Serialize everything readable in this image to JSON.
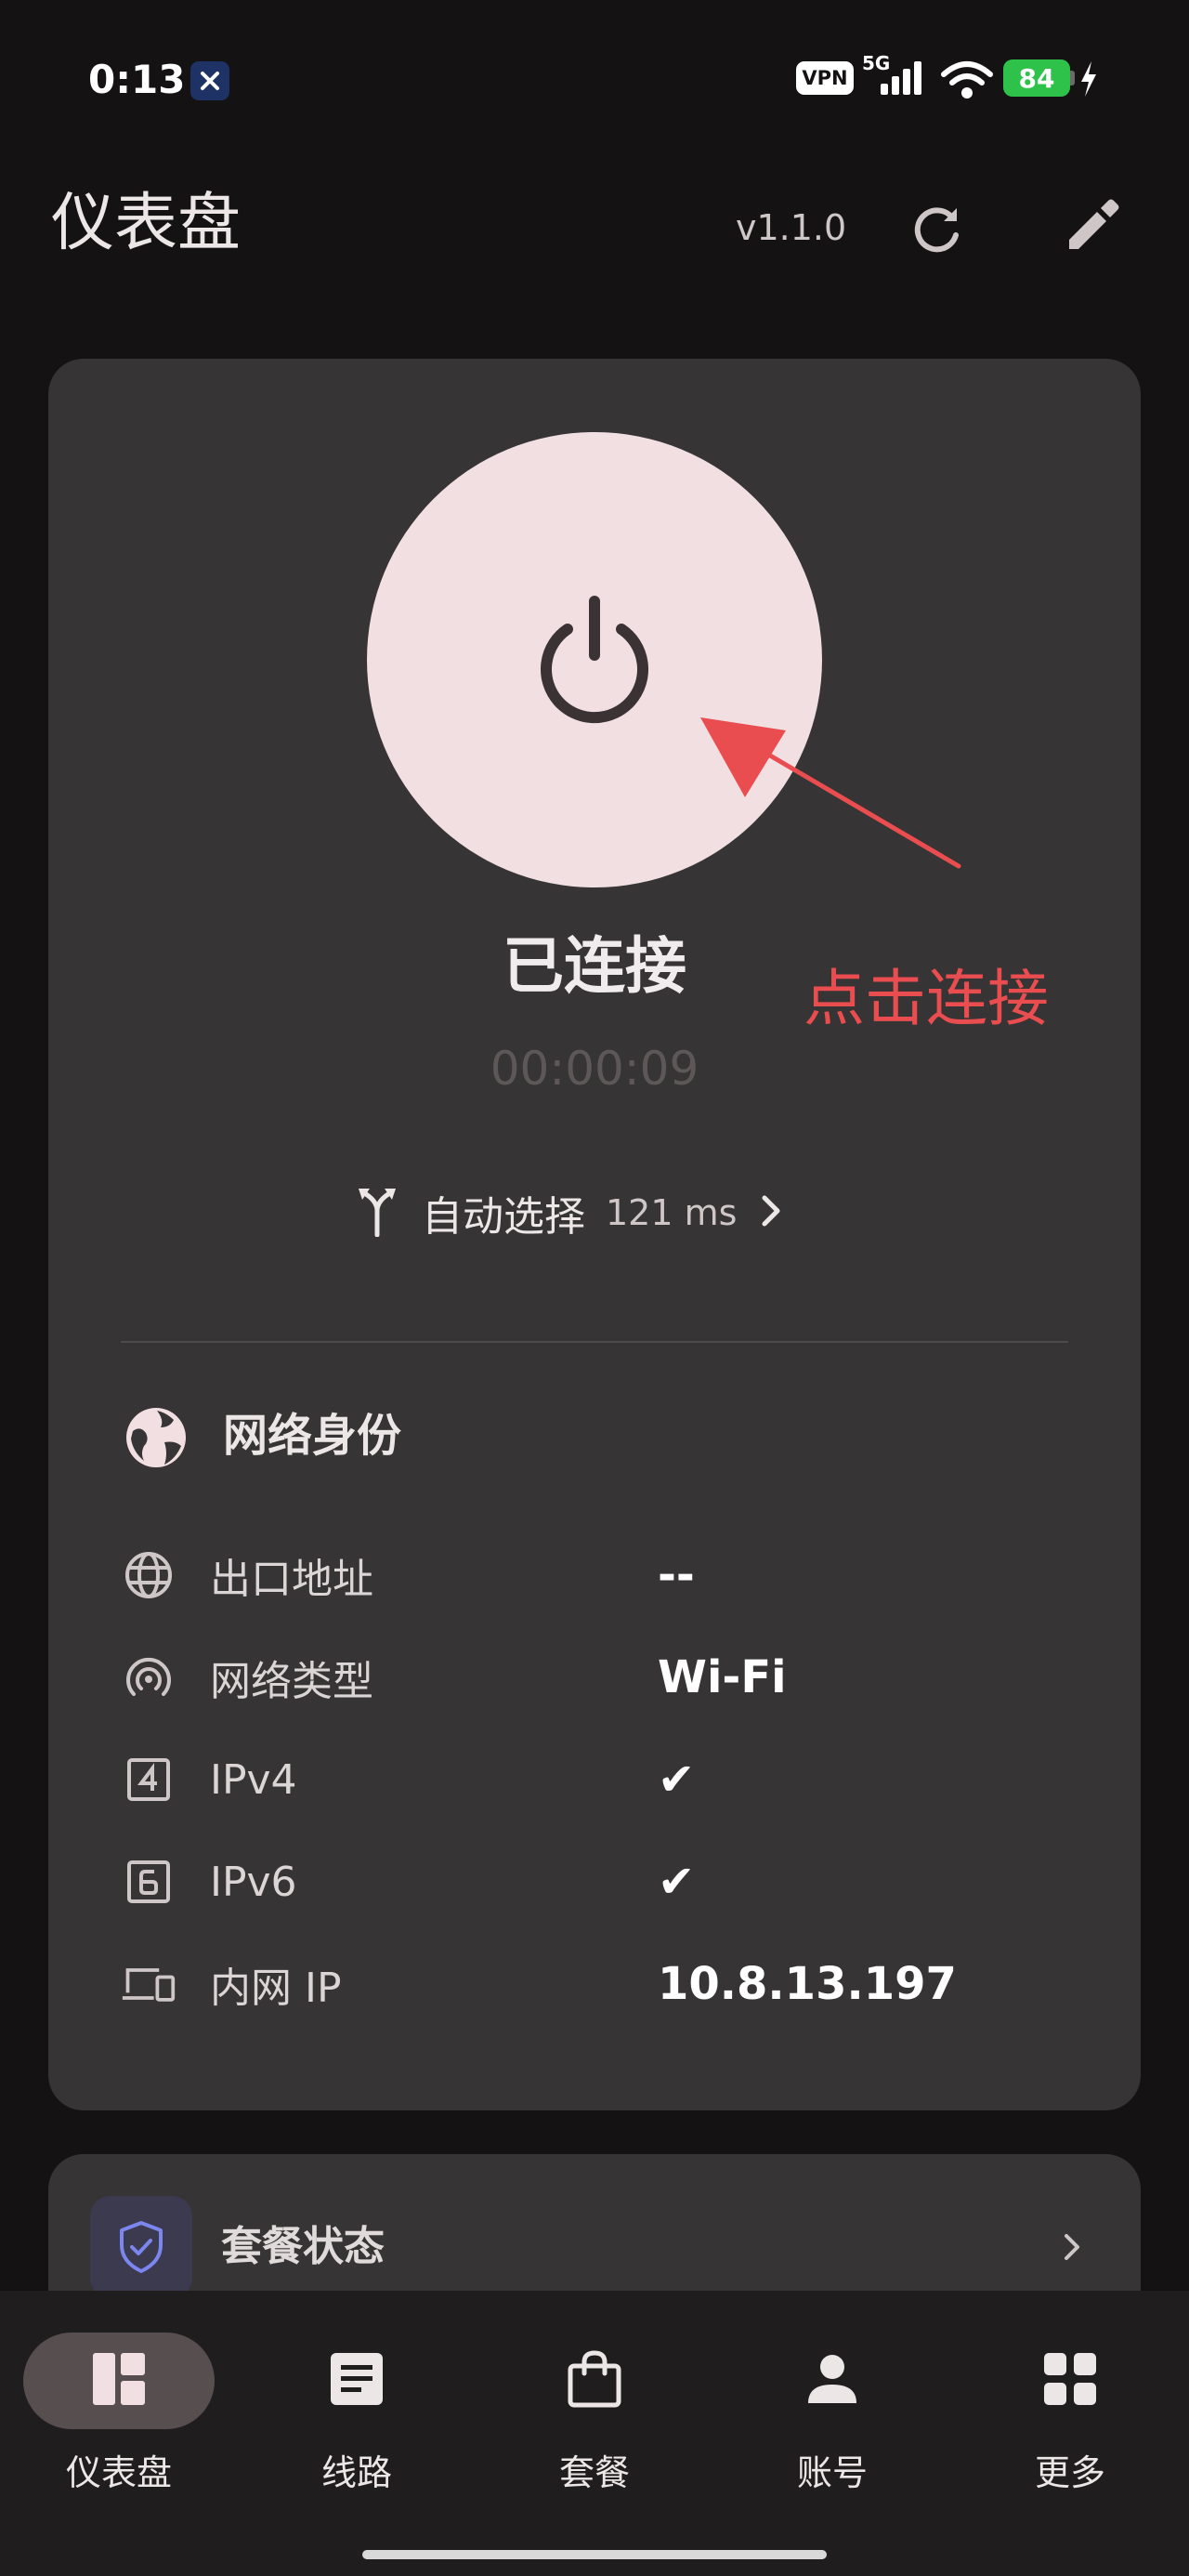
{
  "status_bar": {
    "time": "0:13",
    "app_badge_icon": "close-x-icon",
    "vpn": "VPN",
    "network": "5G",
    "battery": "84"
  },
  "header": {
    "title": "仪表盘",
    "version": "v1.1.0",
    "refresh_icon": "refresh-icon",
    "edit_icon": "pencil-icon"
  },
  "connection": {
    "power_icon": "power-icon",
    "status": "已连接",
    "timer": "00:00:09",
    "annotation": "点击连接",
    "annotation_color": "#ea4d4f",
    "route_icon": "fork-icon",
    "route_label": "自动选择",
    "latency": "121 ms"
  },
  "network_identity": {
    "title": "网络身份",
    "rows": [
      {
        "icon": "globe-icon",
        "label": "出口地址",
        "value": "--"
      },
      {
        "icon": "wifi-tethering-icon",
        "label": "网络类型",
        "value": "Wi-Fi"
      },
      {
        "icon": "ipv4-icon",
        "label": "IPv4",
        "value": "✔"
      },
      {
        "icon": "ipv6-icon",
        "label": "IPv6",
        "value": "✔"
      },
      {
        "icon": "devices-icon",
        "label": "内网 IP",
        "value": "10.8.13.197"
      }
    ]
  },
  "plan": {
    "title": "套餐状态",
    "icon": "shield-check-icon"
  },
  "bottom_nav": {
    "items": [
      {
        "label": "仪表盘",
        "icon": "dashboard-icon",
        "active": true
      },
      {
        "label": "线路",
        "icon": "article-icon",
        "active": false
      },
      {
        "label": "套餐",
        "icon": "shopping-bag-icon",
        "active": false
      },
      {
        "label": "账号",
        "icon": "person-icon",
        "active": false
      },
      {
        "label": "更多",
        "icon": "apps-grid-icon",
        "active": false
      }
    ]
  },
  "colors": {
    "background": "#141213",
    "card": "#363434",
    "power_button": "#f2dfe2",
    "accent_nav": "#574e50"
  }
}
